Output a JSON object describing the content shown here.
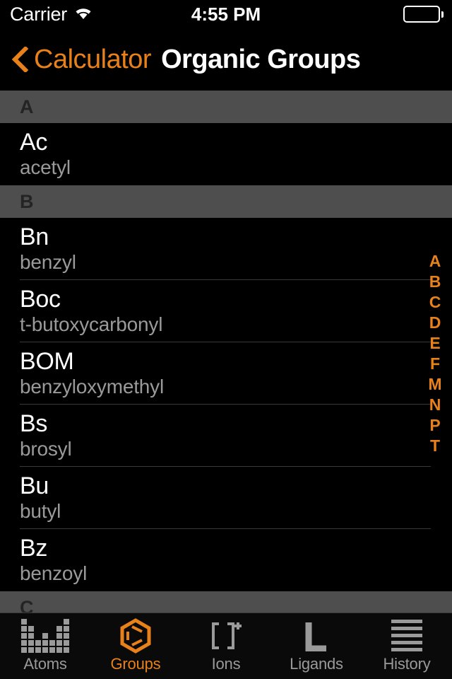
{
  "status_bar": {
    "carrier": "Carrier",
    "wifi_icon": "wifi-icon",
    "time": "4:55 PM",
    "battery_icon": "battery-full-icon"
  },
  "navigation": {
    "back_icon": "chevron-left-icon",
    "back_label": "Calculator",
    "title": "Organic Groups"
  },
  "colors": {
    "accent": "#E8811A",
    "background": "#000000",
    "section_header_bg": "#4E4E4E",
    "section_header_text": "#242424",
    "row_title": "#FFFFFF",
    "row_subtitle": "#9A9A9A",
    "separator": "#3A3A3A",
    "tab_inactive": "#9A9A9A"
  },
  "list": {
    "sections": [
      {
        "letter": "A",
        "rows": [
          {
            "abbr": "Ac",
            "name": "acetyl"
          }
        ]
      },
      {
        "letter": "B",
        "rows": [
          {
            "abbr": "Bn",
            "name": "benzyl"
          },
          {
            "abbr": "Boc",
            "name": "t-butoxycarbonyl"
          },
          {
            "abbr": "BOM",
            "name": "benzyloxymethyl"
          },
          {
            "abbr": "Bs",
            "name": "brosyl"
          },
          {
            "abbr": "Bu",
            "name": "butyl"
          },
          {
            "abbr": "Bz",
            "name": "benzoyl"
          }
        ]
      },
      {
        "letter": "C",
        "rows": []
      }
    ]
  },
  "index_bar": {
    "letters": [
      "A",
      "B",
      "C",
      "D",
      "E",
      "F",
      "M",
      "N",
      "P",
      "T"
    ]
  },
  "tab_bar": {
    "tabs": [
      {
        "label": "Atoms",
        "icon": "periodic-table-icon",
        "active": false
      },
      {
        "label": "Groups",
        "icon": "benzene-ring-icon",
        "active": true
      },
      {
        "label": "Ions",
        "icon": "ion-brackets-icon",
        "active": false
      },
      {
        "label": "Ligands",
        "icon": "ligand-l-icon",
        "active": false
      },
      {
        "label": "History",
        "icon": "list-lines-icon",
        "active": false
      }
    ]
  }
}
